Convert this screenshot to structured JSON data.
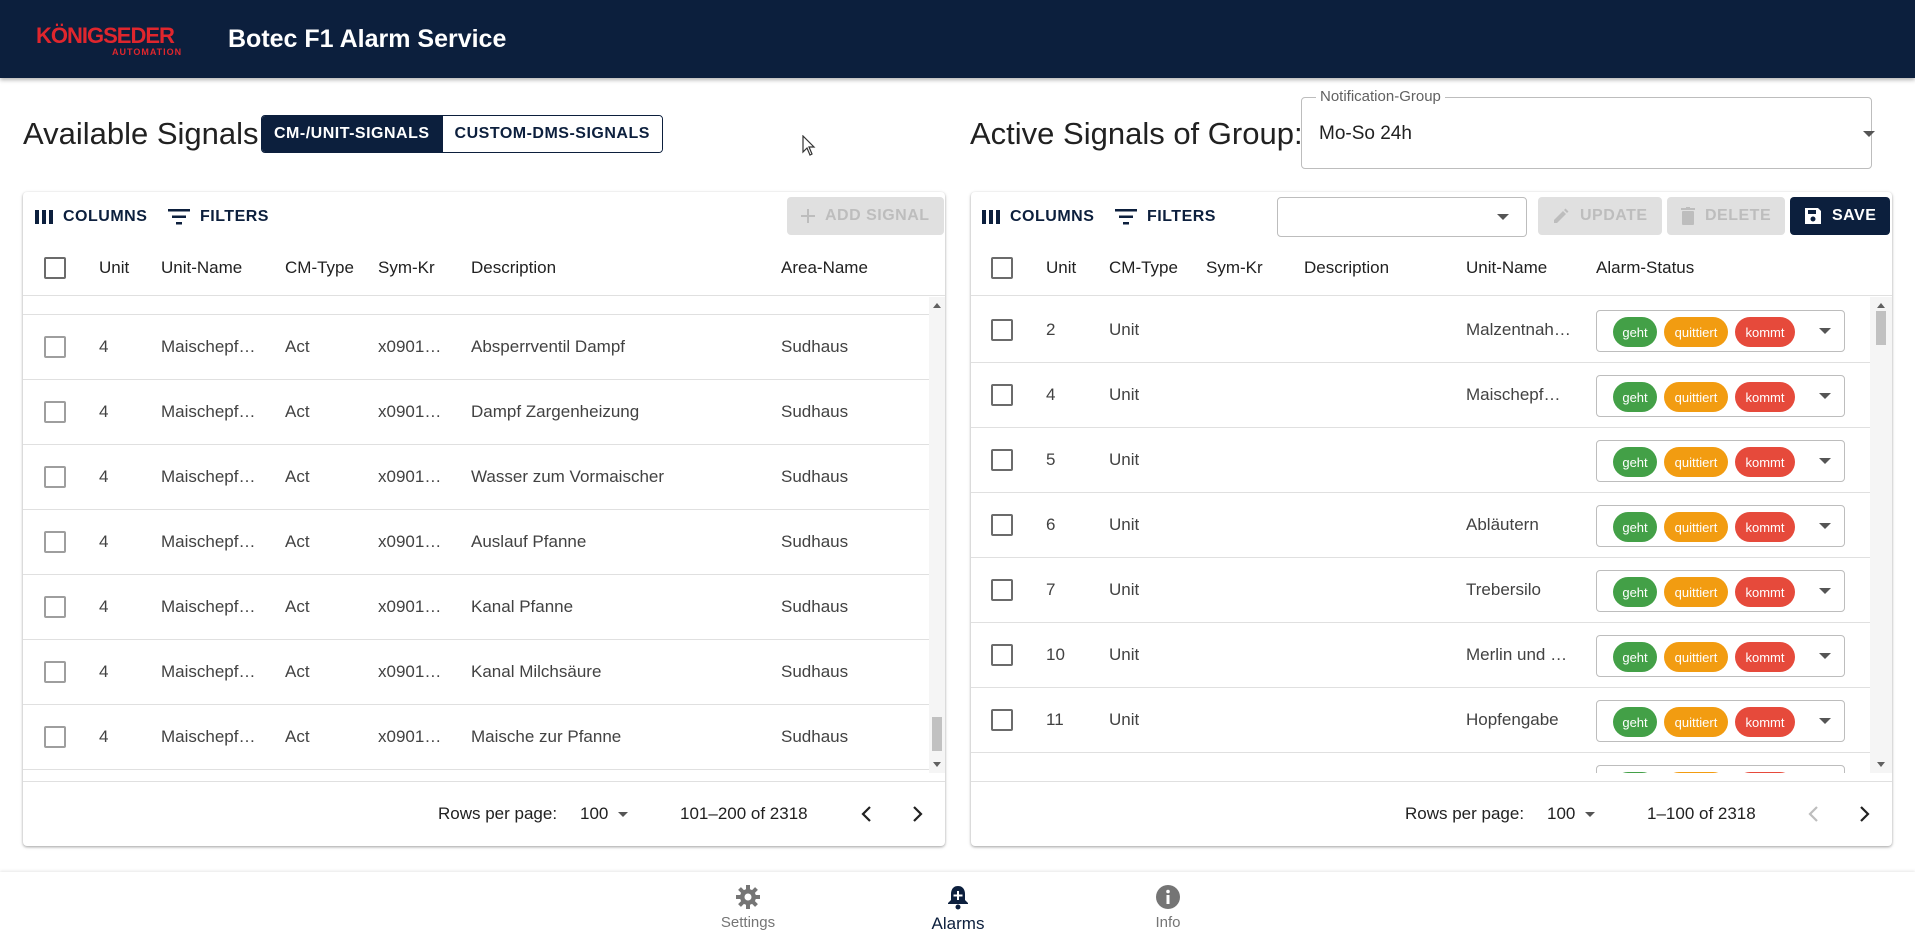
{
  "header": {
    "logo_text": "KÖNIGSEDER",
    "logo_sub": "AUTOMATION",
    "app_title": "Botec F1 Alarm Service"
  },
  "left": {
    "heading": "Available Signals",
    "toggle": [
      "CM-/UNIT-SIGNALS",
      "CUSTOM-DMS-SIGNALS"
    ],
    "toolbar": {
      "columns": "COLUMNS",
      "filters": "FILTERS",
      "add_signal": "ADD SIGNAL"
    },
    "columns": [
      "Unit",
      "Unit-Name",
      "CM-Type",
      "Sym-Kr",
      "Description",
      "Area-Name"
    ],
    "rows": [
      [
        "4",
        "Maischepf…",
        "Act",
        "x0901…",
        "Absperrventil Dampf",
        "Sudhaus"
      ],
      [
        "4",
        "Maischepf…",
        "Act",
        "x0901…",
        "Dampf Zargenheizung",
        "Sudhaus"
      ],
      [
        "4",
        "Maischepf…",
        "Act",
        "x0901…",
        "Wasser zum Vormaischer",
        "Sudhaus"
      ],
      [
        "4",
        "Maischepf…",
        "Act",
        "x0901…",
        "Auslauf Pfanne",
        "Sudhaus"
      ],
      [
        "4",
        "Maischepf…",
        "Act",
        "x0901…",
        "Kanal Pfanne",
        "Sudhaus"
      ],
      [
        "4",
        "Maischepf…",
        "Act",
        "x0901…",
        "Kanal Milchsäure",
        "Sudhaus"
      ],
      [
        "4",
        "Maischepf…",
        "Act",
        "x0901…",
        "Maische zur Pfanne",
        "Sudhaus"
      ]
    ],
    "pager": {
      "rows_per_page_label": "Rows per page:",
      "rows_per_page": "100",
      "range": "101–200 of 2318"
    }
  },
  "right": {
    "heading": "Active Signals of Group:",
    "group_label": "Notification-Group",
    "group_value": "Mo-So 24h",
    "toolbar": {
      "columns": "COLUMNS",
      "filters": "FILTERS",
      "update": "UPDATE",
      "delete": "DELETE",
      "save": "SAVE"
    },
    "columns": [
      "Unit",
      "CM-Type",
      "Sym-Kr",
      "Description",
      "Unit-Name",
      "Alarm-Status"
    ],
    "chips": [
      "geht",
      "quittiert",
      "kommt"
    ],
    "rows": [
      [
        "2",
        "Unit",
        "",
        "",
        "Malzentnah…"
      ],
      [
        "4",
        "Unit",
        "",
        "",
        "Maischepf…"
      ],
      [
        "5",
        "Unit",
        "",
        "",
        ""
      ],
      [
        "6",
        "Unit",
        "",
        "",
        "Abläutern"
      ],
      [
        "7",
        "Unit",
        "",
        "",
        "Trebersilo"
      ],
      [
        "10",
        "Unit",
        "",
        "",
        "Merlin und …"
      ],
      [
        "11",
        "Unit",
        "",
        "",
        "Hopfengabe"
      ]
    ],
    "pager": {
      "rows_per_page_label": "Rows per page:",
      "rows_per_page": "100",
      "range": "1–100 of 2318"
    }
  },
  "bottom_nav": [
    "Settings",
    "Alarms",
    "Info"
  ],
  "colors": {
    "primary": "#0c1f3d",
    "geht": "#43a047",
    "quittiert": "#f29c11",
    "kommt": "#e64a3b",
    "logo": "#e0262d"
  }
}
